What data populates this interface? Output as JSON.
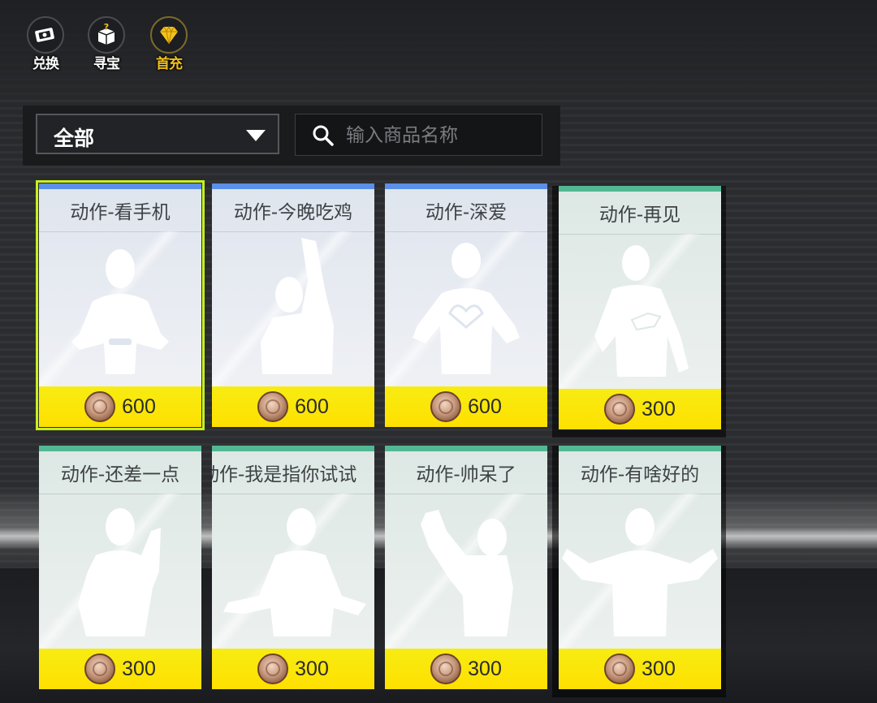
{
  "top_menu": [
    {
      "label": "兑换",
      "icon": "exchange-ticket-icon"
    },
    {
      "label": "寻宝",
      "icon": "mystery-box-icon"
    },
    {
      "label": "首充",
      "icon": "diamond-icon"
    }
  ],
  "filter": {
    "category": "全部",
    "search_placeholder": "输入商品名称"
  },
  "items": [
    {
      "title": "动作-看手机",
      "price": "600",
      "selected": true
    },
    {
      "title": "动作-今晚吃鸡",
      "price": "600"
    },
    {
      "title": "动作-深爱",
      "price": "600"
    },
    {
      "title": "动作-再见",
      "price": "300"
    },
    {
      "title": "动作-还差一点",
      "price": "300"
    },
    {
      "title": "动作-我是指你试试",
      "price": "300"
    },
    {
      "title": "动作-帅呆了",
      "price": "300"
    },
    {
      "title": "动作-有啥好的",
      "price": "300"
    }
  ],
  "colors": {
    "accent_yellow": "#ffe000",
    "rarity_blue": "#5b8fe8",
    "rarity_green": "#52b894",
    "selection": "#c6f01f",
    "gold_label": "#f4c21a"
  }
}
